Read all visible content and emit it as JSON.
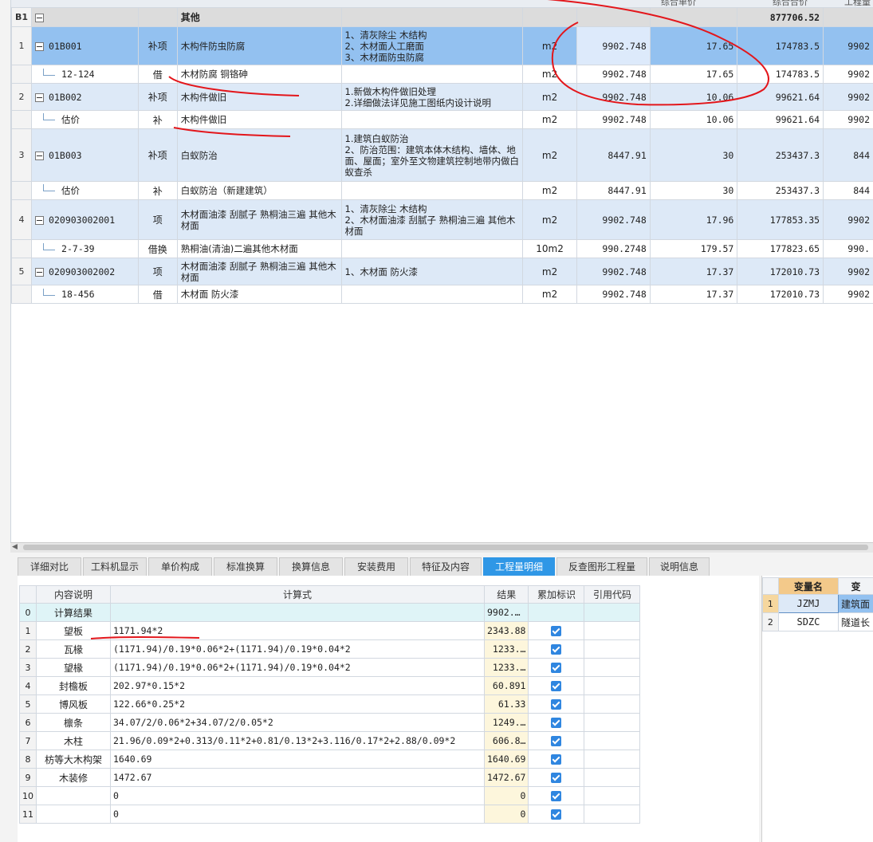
{
  "top_header": [
    "综合单价",
    "综合合价",
    "工程量"
  ],
  "top_rows": [
    {
      "type": "group",
      "rn": "B1",
      "code": "",
      "cat": "",
      "name": "其他",
      "feature": "",
      "unit": "",
      "qty": "",
      "price": "",
      "total": "877706.52",
      "last": ""
    },
    {
      "type": "sel",
      "rn": "1",
      "code": "01B001",
      "cat": "补项",
      "name": "木构件防虫防腐",
      "feature": "1、清灰除尘 木结构\n2、木材面人工磨面\n3、木材面防虫防腐",
      "unit": "m2",
      "qty": "9902.748",
      "price": "17.65",
      "total": "174783.5",
      "last": "9902"
    },
    {
      "type": "sub",
      "rn": "",
      "code": "12-124",
      "cat": "借",
      "name": "木材防腐 铜铬砷",
      "feature": "",
      "unit": "m2",
      "qty": "9902.748",
      "price": "17.65",
      "total": "174783.5",
      "last": "9902"
    },
    {
      "type": "main",
      "rn": "2",
      "code": "01B002",
      "cat": "补项",
      "name": "木构件做旧",
      "feature": "1.新做木构件做旧处理\n2.详细做法详见施工图纸内设计说明",
      "unit": "m2",
      "qty": "9902.748",
      "price": "10.06",
      "total": "99621.64",
      "last": "9902"
    },
    {
      "type": "sub",
      "rn": "",
      "code": "估价",
      "cat": "补",
      "name": "木构件做旧",
      "feature": "",
      "unit": "m2",
      "qty": "9902.748",
      "price": "10.06",
      "total": "99621.64",
      "last": "9902"
    },
    {
      "type": "main",
      "rn": "3",
      "code": "01B003",
      "cat": "补项",
      "name": "白蚁防治",
      "feature": "1.建筑白蚁防治\n2、防治范围：建筑本体木结构、墙体、地面、屋面；室外至文物建筑控制地带内做白蚁查杀",
      "unit": "m2",
      "qty": "8447.91",
      "price": "30",
      "total": "253437.3",
      "last": "844"
    },
    {
      "type": "sub",
      "rn": "",
      "code": "估价",
      "cat": "补",
      "name": "白蚁防治（新建建筑）",
      "feature": "",
      "unit": "m2",
      "qty": "8447.91",
      "price": "30",
      "total": "253437.3",
      "last": "844"
    },
    {
      "type": "main",
      "rn": "4",
      "code": "020903002001",
      "cat": "项",
      "name": "木材面油漆 刮腻子 熟桐油三遍 其他木材面",
      "feature": "1、清灰除尘 木结构\n2、木材面油漆 刮腻子 熟桐油三遍 其他木材面",
      "unit": "m2",
      "qty": "9902.748",
      "price": "17.96",
      "total": "177853.35",
      "last": "9902"
    },
    {
      "type": "sub",
      "rn": "",
      "code": "2-7-39",
      "cat": "借换",
      "name": "熟桐油(清油)二遍其他木材面",
      "feature": "",
      "unit": "10m2",
      "qty": "990.2748",
      "price": "179.57",
      "total": "177823.65",
      "last": "990."
    },
    {
      "type": "main",
      "rn": "5",
      "code": "020903002002",
      "cat": "项",
      "name": "木材面油漆 刮腻子 熟桐油三遍 其他木材面",
      "feature": "1、木材面 防火漆",
      "unit": "m2",
      "qty": "9902.748",
      "price": "17.37",
      "total": "172010.73",
      "last": "9902"
    },
    {
      "type": "sub",
      "rn": "",
      "code": "18-456",
      "cat": "借",
      "name": "木材面 防火漆",
      "feature": "",
      "unit": "m2",
      "qty": "9902.748",
      "price": "17.37",
      "total": "172010.73",
      "last": "9902"
    }
  ],
  "tabs": [
    "详细对比",
    "工料机显示",
    "单价构成",
    "标准换算",
    "换算信息",
    "安装费用",
    "特征及内容",
    "工程量明细",
    "反查图形工程量",
    "说明信息"
  ],
  "active_tab": "工程量明细",
  "qty_header": {
    "desc": "内容说明",
    "formula": "计算式",
    "result": "结果",
    "flag": "累加标识",
    "ref": "引用代码"
  },
  "qty_rows": [
    {
      "rn": "0",
      "desc": "计算结果",
      "formula": "",
      "result": "9902.…",
      "checked": false
    },
    {
      "rn": "1",
      "desc": "望板",
      "formula": "1171.94*2",
      "result": "2343.88",
      "checked": true
    },
    {
      "rn": "2",
      "desc": "瓦椽",
      "formula": "(1171.94)/0.19*0.06*2+(1171.94)/0.19*0.04*2",
      "result": "1233.…",
      "checked": true
    },
    {
      "rn": "3",
      "desc": "望椽",
      "formula": "(1171.94)/0.19*0.06*2+(1171.94)/0.19*0.04*2",
      "result": "1233.…",
      "checked": true
    },
    {
      "rn": "4",
      "desc": "封檐板",
      "formula": "202.97*0.15*2",
      "result": "60.891",
      "checked": true
    },
    {
      "rn": "5",
      "desc": "博风板",
      "formula": "122.66*0.25*2",
      "result": "61.33",
      "checked": true
    },
    {
      "rn": "6",
      "desc": "檩条",
      "formula": "34.07/2/0.06*2+34.07/2/0.05*2",
      "result": "1249.…",
      "checked": true
    },
    {
      "rn": "7",
      "desc": "木柱",
      "formula": "21.96/0.09*2+0.313/0.11*2+0.81/0.13*2+3.116/0.17*2+2.88/0.09*2",
      "result": "606.8…",
      "checked": true
    },
    {
      "rn": "8",
      "desc": "枋等大木构架",
      "formula": "1640.69",
      "result": "1640.69",
      "checked": true
    },
    {
      "rn": "9",
      "desc": "木装修",
      "formula": "1472.67",
      "result": "1472.67",
      "checked": true
    },
    {
      "rn": "10",
      "desc": "",
      "formula": "0",
      "result": "0",
      "checked": true
    },
    {
      "rn": "11",
      "desc": "",
      "formula": "0",
      "result": "0",
      "checked": true
    }
  ],
  "var_header": {
    "name": "变量名",
    "value": "变"
  },
  "var_rows": [
    {
      "rn": "1",
      "name": "JZMJ",
      "value": "建筑面"
    },
    {
      "rn": "2",
      "name": "SDZC",
      "value": "隧道长"
    }
  ],
  "colors": {
    "selected_row": "#93c1f0",
    "main_row": "#dde9f7",
    "group_row": "#dcdcdc",
    "active_tab": "#2f97e6",
    "annotation": "#e3161b"
  }
}
